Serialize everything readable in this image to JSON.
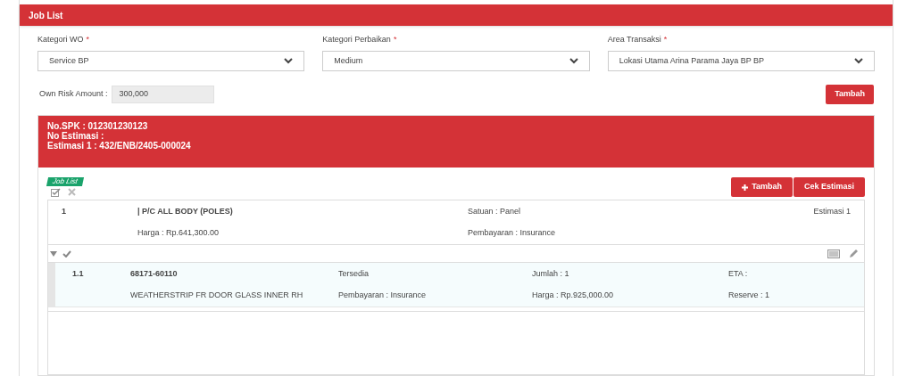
{
  "panel": {
    "title": "Job List"
  },
  "fields": [
    {
      "label": "Kategori WO",
      "mark": "*",
      "value": "Service BP"
    },
    {
      "label": "Kategori Perbaikan",
      "mark": "*",
      "value": "Medium"
    },
    {
      "label": "Area Transaksi",
      "mark": "*",
      "value": "Lokasi Utama Arina Parama Jaya BP BP"
    }
  ],
  "own_risk": {
    "label": "Own Risk Amount :",
    "value": "300,000"
  },
  "add_button": "Tambah",
  "estimate": {
    "lines": [
      "No.SPK : 012301230123",
      "No Estimasi :",
      "Estimasi 1 : 432/ENB/2405-000024"
    ],
    "tag": "Job List",
    "add_button": "Tambah",
    "check_button": "Cek Estimasi",
    "jobs": [
      {
        "number": "1",
        "name": "| P/C ALL BODY (POLES)",
        "price": "Harga : Rp.641,300.00",
        "unit": "Satuan : Panel",
        "payment": "Pembayaran : Insurance",
        "estimate": "Estimasi 1",
        "expanded": true,
        "parts": [
          {
            "number": "1.1",
            "code": "68171-60110",
            "name": "WEATHERSTRIP FR DOOR GLASS INNER RH",
            "availability": "Tersedia",
            "payment": "Pembayaran : Insurance",
            "quantity": "Jumlah : 1",
            "price": "Harga : Rp.925,000.00",
            "eta": "ETA :",
            "reserve": "Reserve : 1"
          }
        ]
      }
    ]
  }
}
